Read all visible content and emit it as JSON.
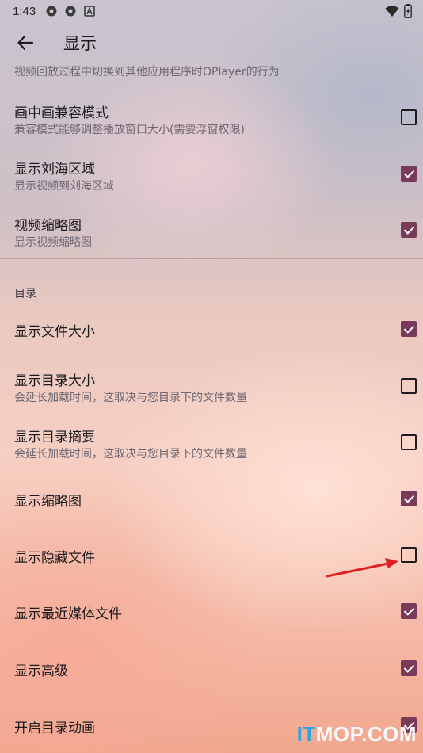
{
  "status_bar": {
    "time": "1:43",
    "icons": [
      "settings-gear-icon",
      "settings-gear-icon",
      "font-a-icon",
      "wifi-icon",
      "battery-charging-icon"
    ]
  },
  "app_bar": {
    "back_icon": "arrow-back-icon",
    "title": "显示"
  },
  "cut_off_summary": "视频回放过程中切换到其他应用程序时OPlayer的行为",
  "video_settings": [
    {
      "title": "画中画兼容模式",
      "summary": "兼容模式能够调整播放窗口大小(需要浮窗权限)",
      "checked": false
    },
    {
      "title": "显示刘海区域",
      "summary": "显示视频到刘海区域",
      "checked": true
    },
    {
      "title": "视频缩略图",
      "summary": "显示视频缩略图",
      "checked": true
    }
  ],
  "directory_section": {
    "header": "目录",
    "items": [
      {
        "title": "显示文件大小",
        "summary": "",
        "checked": true
      },
      {
        "title": "显示目录大小",
        "summary": "会延长加载时间，这取决与您目录下的文件数量",
        "checked": false
      },
      {
        "title": "显示目录摘要",
        "summary": "会延长加载时间，这取决与您目录下的文件数量",
        "checked": false
      },
      {
        "title": "显示缩略图",
        "summary": "",
        "checked": true
      },
      {
        "title": "显示隐藏文件",
        "summary": "",
        "checked": false
      },
      {
        "title": "显示最近媒体文件",
        "summary": "",
        "checked": true
      },
      {
        "title": "显示高级",
        "summary": "",
        "checked": true
      },
      {
        "title": "开启目录动画",
        "summary": "",
        "checked": true
      }
    ]
  },
  "annotation": {
    "arrow_color": "#e02020",
    "points_to": "显示隐藏文件"
  },
  "watermark": {
    "part1": "IT",
    "part2": "MOP.COM"
  },
  "colors": {
    "checkbox_checked": "#7a3a5a",
    "text_primary": "#1c1b1f",
    "text_secondary": "#6d6570"
  }
}
